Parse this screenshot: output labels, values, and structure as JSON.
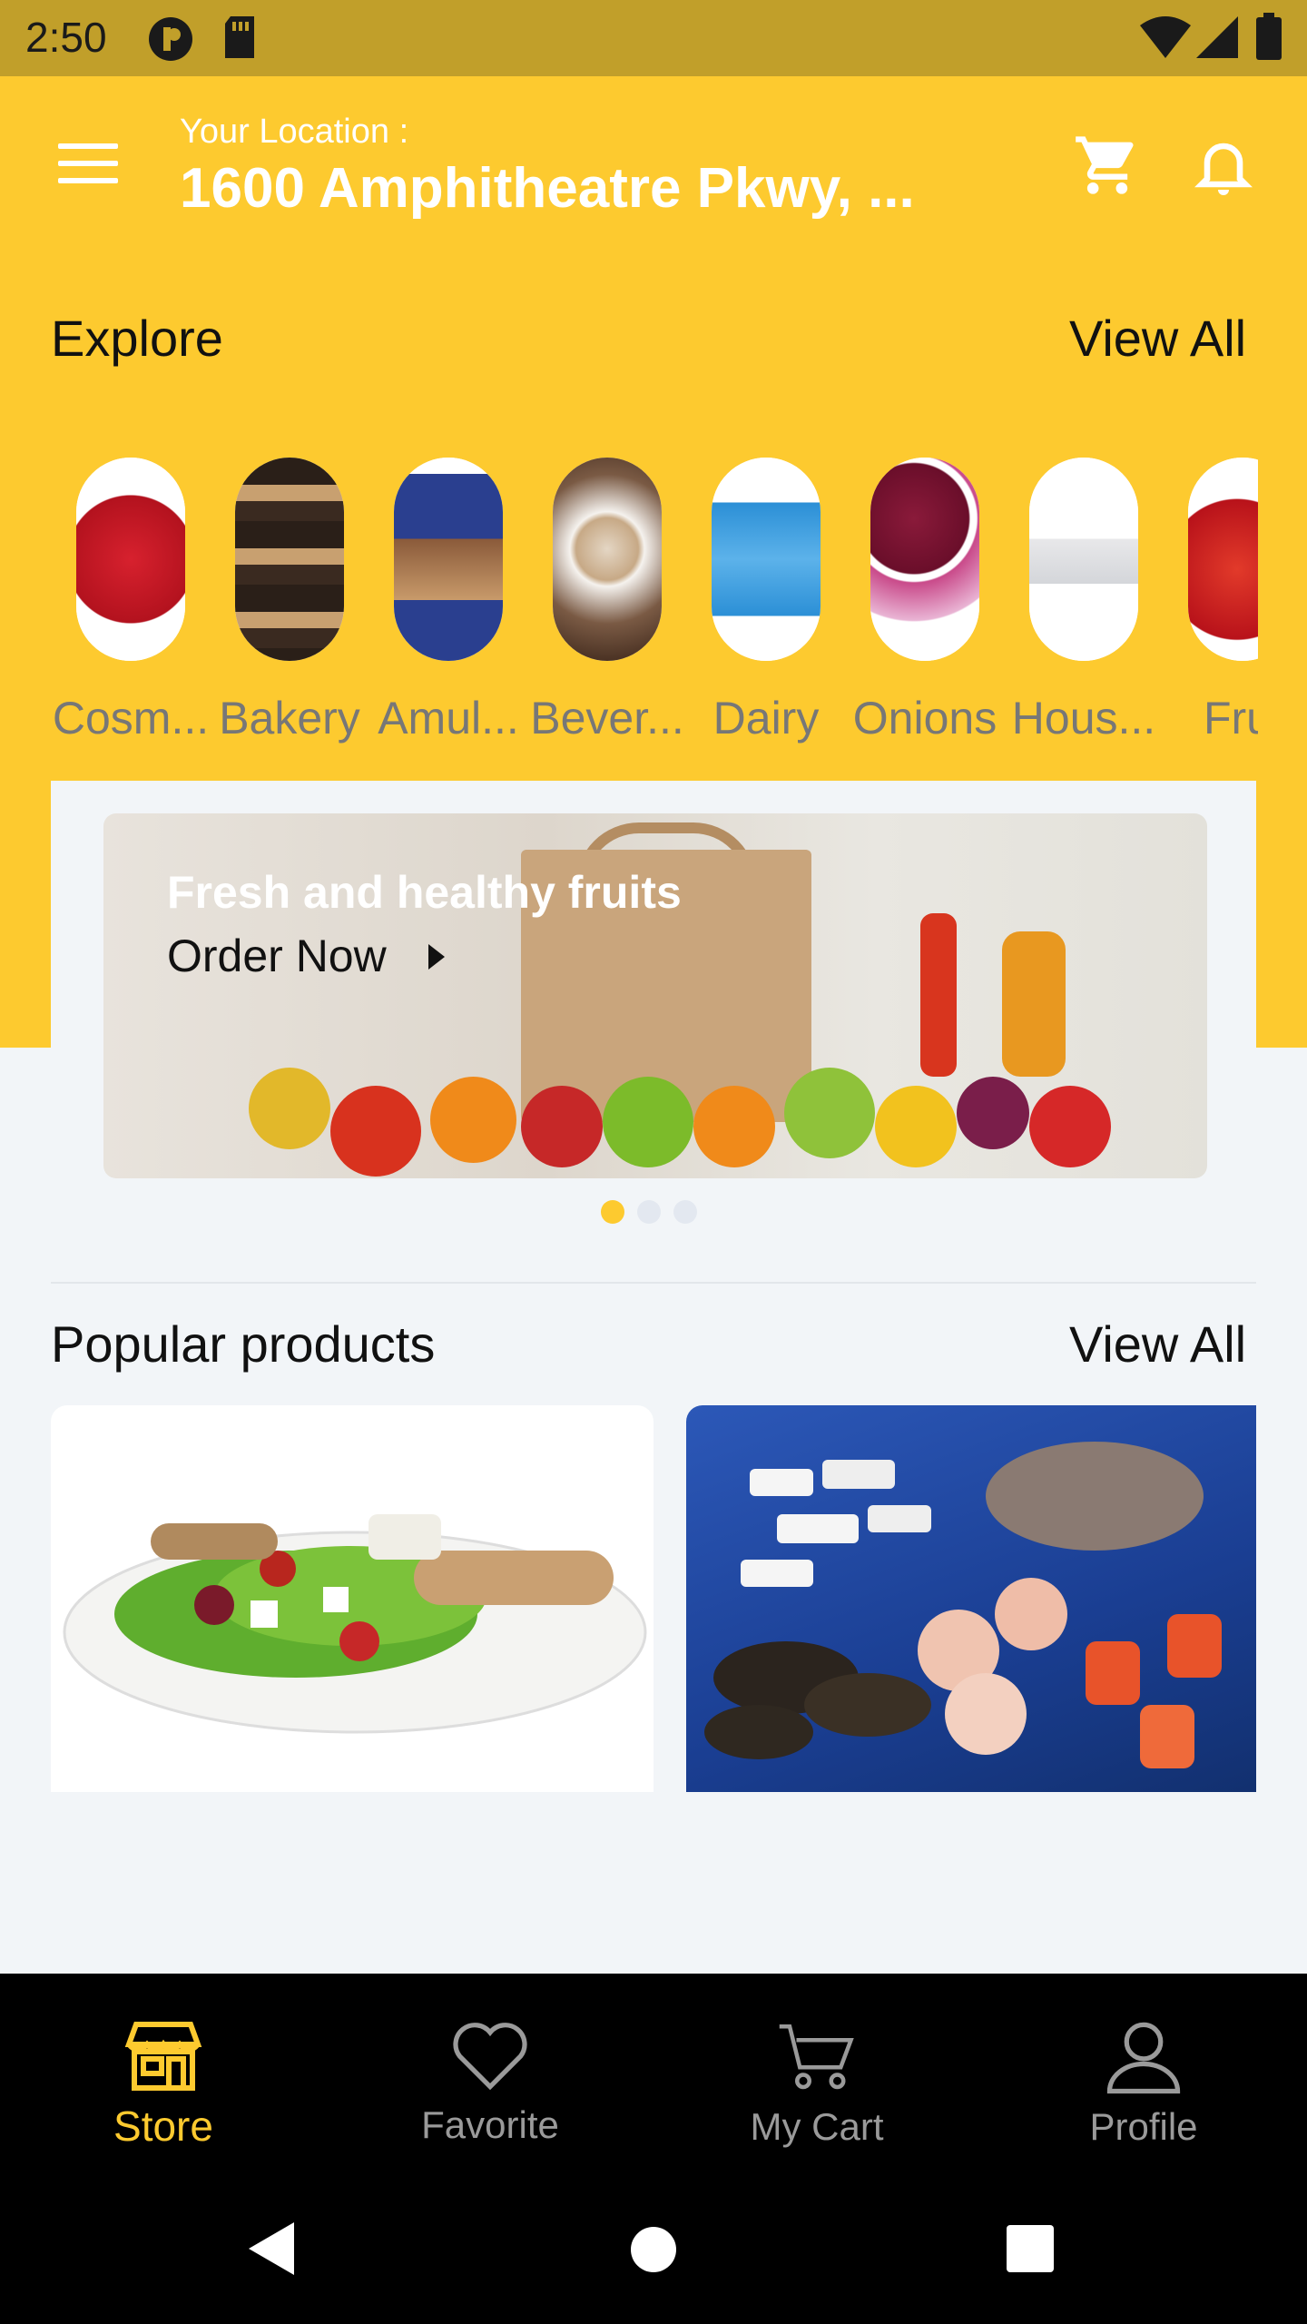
{
  "status_bar": {
    "time": "2:50"
  },
  "header": {
    "location_label": "Your Location :",
    "location_value": "1600 Amphitheatre Pkwy, ..."
  },
  "explore": {
    "title": "Explore",
    "view_all": "View All",
    "categories": [
      {
        "label": "Cosm..."
      },
      {
        "label": "Bakery"
      },
      {
        "label": "Amul..."
      },
      {
        "label": "Bever..."
      },
      {
        "label": "Dairy"
      },
      {
        "label": "Onions"
      },
      {
        "label": "Hous..."
      },
      {
        "label": "Frui"
      }
    ]
  },
  "banner": {
    "headline": "Fresh and healthy fruits",
    "cta": "Order Now",
    "active_slide": 1,
    "slide_count": 3
  },
  "popular": {
    "title": "Popular products",
    "view_all": "View All"
  },
  "bottom_nav": {
    "items": [
      {
        "label": "Store",
        "icon": "store-icon",
        "active": true
      },
      {
        "label": "Favorite",
        "icon": "heart-icon",
        "active": false
      },
      {
        "label": "My Cart",
        "icon": "cart-icon",
        "active": false
      },
      {
        "label": "Profile",
        "icon": "profile-icon",
        "active": false
      }
    ]
  },
  "colors": {
    "accent": "#fdca2f",
    "status_bar": "#c19f2a",
    "background": "#f2f5f8"
  }
}
